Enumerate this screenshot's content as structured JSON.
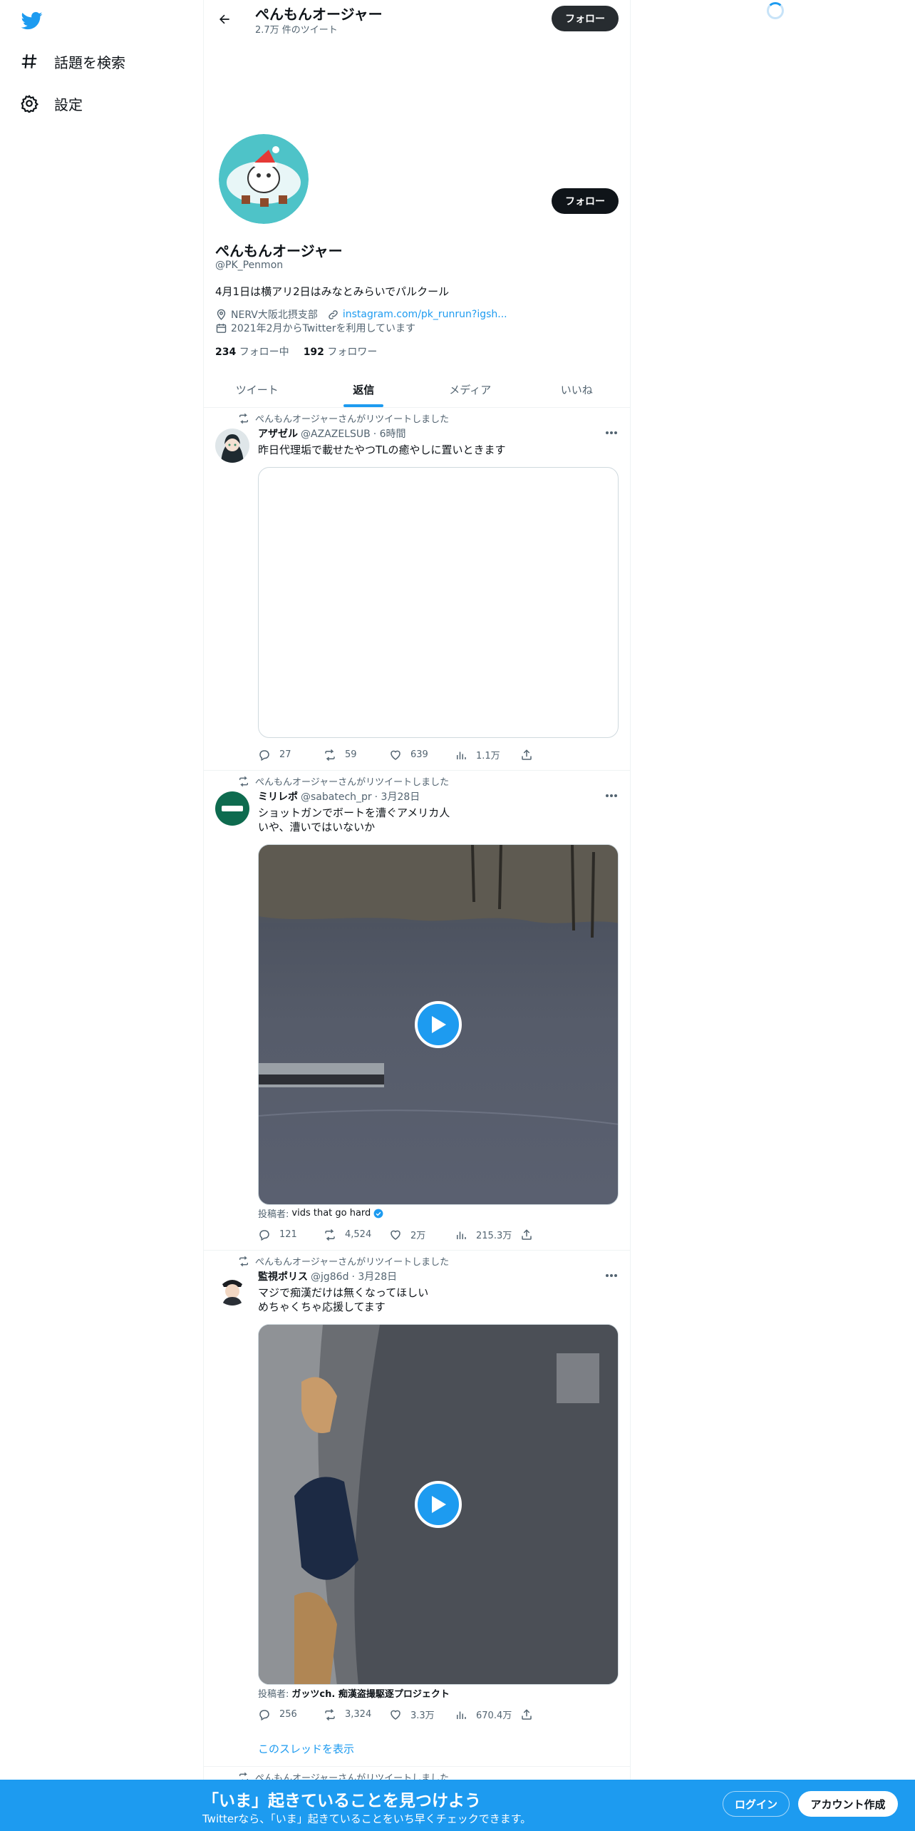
{
  "nav": {
    "items": [
      {
        "icon": "hashtag-icon",
        "label": "話題を検索"
      },
      {
        "icon": "gear-icon",
        "label": "設定"
      }
    ]
  },
  "header": {
    "title": "ぺんもんオージャー",
    "tweet_count": "2.7万 件のツイート",
    "follow_label": "フォロー"
  },
  "profile": {
    "name": "ぺんもんオージャー",
    "handle": "@PK_Penmon",
    "bio": "4月1日は横アリ2日はみなとみらいでパルクール",
    "location": "NERV大阪北摂支部",
    "link": "instagram.com/pk_runrun?igsh...",
    "joined": "2021年2月からTwitterを利用しています",
    "following_count": "234",
    "following_label": "フォロー中",
    "followers_count": "192",
    "followers_label": "フォロワー",
    "follow_label": "フォロー"
  },
  "tabs": [
    {
      "label": "ツイート",
      "active": false
    },
    {
      "label": "返信",
      "active": true
    },
    {
      "label": "メディア",
      "active": false
    },
    {
      "label": "いいね",
      "active": false
    }
  ],
  "tweets": [
    {
      "retweet_label": "ぺんもんオージャーさんがリツイートしました",
      "name": "アザゼル",
      "handle": "@AZAZELSUB",
      "time": "· 6時間",
      "text_lines": [
        "昨日代理垢で載せたやつTLの癒やしに置いときます"
      ],
      "byline_prefix": "",
      "byline_name": "",
      "stats": {
        "replies": "27",
        "retweets": "59",
        "likes": "639",
        "views": "1.1万"
      }
    },
    {
      "retweet_label": "ぺんもんオージャーさんがリツイートしました",
      "name": "ミリレポ",
      "handle": "@sabatech_pr",
      "time": "· 3月28日",
      "text_lines": [
        "ショットガンでボートを漕ぐアメリカ人",
        "いや、漕いではいないか"
      ],
      "byline_prefix": "投稿者:",
      "byline_name": "vids that go hard",
      "stats": {
        "replies": "121",
        "retweets": "4,524",
        "likes": "2万",
        "views": "215.3万"
      }
    },
    {
      "retweet_label": "ぺんもんオージャーさんがリツイートしました",
      "name": "監視ポリス",
      "handle": "@jg86d",
      "time": "· 3月28日",
      "text_lines": [
        "マジで痴漢だけは無くなってほしい",
        "めちゃくちゃ応援してます"
      ],
      "byline_prefix": "投稿者:",
      "byline_name": "ガッツch. 痴漢盗撮駆逐プロジェクト",
      "stats": {
        "replies": "256",
        "retweets": "3,324",
        "likes": "3.3万",
        "views": "670.4万"
      },
      "thread_link": "このスレッドを表示"
    },
    {
      "retweet_label": "ぺんもんオージャーさんがリツイートしました"
    }
  ],
  "banner": {
    "title": "「いま」起きていることを見つけよう",
    "subtitle": "Twitterなら、「いま」起きていることをいち早くチェックできます。",
    "login_label": "ログイン",
    "signup_label": "アカウント作成"
  },
  "colors": {
    "accent": "#1d9bf0",
    "text": "#0f1419",
    "muted": "#536471"
  }
}
